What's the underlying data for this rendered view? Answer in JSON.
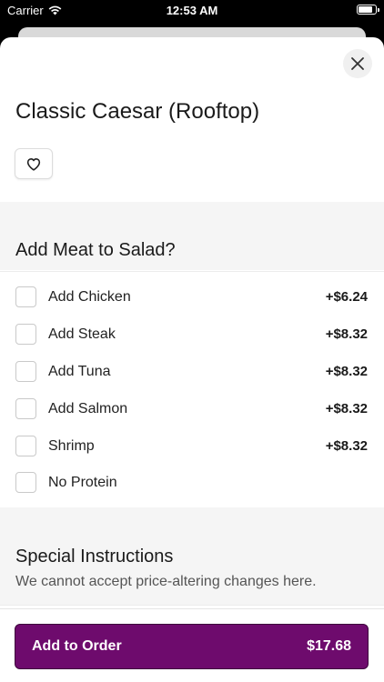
{
  "status_bar": {
    "carrier": "Carrier",
    "time": "12:53 AM"
  },
  "item": {
    "title": "Classic Caesar (Rooftop)"
  },
  "meat_section": {
    "title": "Add Meat to Salad?",
    "options": [
      {
        "label": "Add Chicken",
        "price": "+$6.24",
        "checked": false
      },
      {
        "label": "Add Steak",
        "price": "+$8.32",
        "checked": false
      },
      {
        "label": "Add Tuna",
        "price": "+$8.32",
        "checked": false
      },
      {
        "label": "Add Salmon",
        "price": "+$8.32",
        "checked": false
      },
      {
        "label": "Shrimp",
        "price": "+$8.32",
        "checked": false
      },
      {
        "label": "No Protein",
        "price": "",
        "checked": false
      }
    ]
  },
  "special_instructions": {
    "title": "Special Instructions",
    "description": "We cannot accept price-altering changes here."
  },
  "order_button": {
    "label": "Add to Order",
    "total": "$17.68"
  },
  "icons": {
    "close": "close-icon",
    "favorite": "heart-outline-icon",
    "wifi": "wifi-icon",
    "battery": "battery-icon"
  },
  "colors": {
    "accent": "#6e0b6d",
    "section_background": "#f5f5f5"
  }
}
